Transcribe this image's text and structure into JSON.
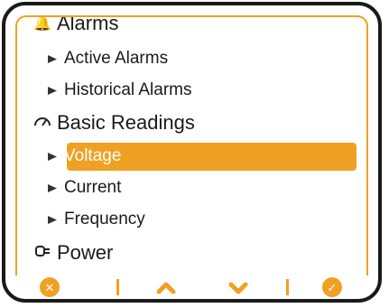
{
  "menu": {
    "items": [
      {
        "type": "section",
        "label": "Alarms",
        "icon": "bell-icon"
      },
      {
        "type": "sub",
        "label": "Active Alarms"
      },
      {
        "type": "sub",
        "label": "Historical Alarms"
      },
      {
        "type": "section",
        "label": "Basic Readings",
        "icon": "gauge-icon"
      },
      {
        "type": "sub",
        "label": "Voltage",
        "selected": true
      },
      {
        "type": "sub",
        "label": "Current"
      },
      {
        "type": "sub",
        "label": "Frequency"
      },
      {
        "type": "section",
        "label": "Power",
        "icon": "plug-icon"
      }
    ]
  },
  "toolbar": {
    "cancel_icon": "close-icon",
    "up_icon": "chevron-up-icon",
    "down_icon": "chevron-down-icon",
    "ok_icon": "checkmark-icon"
  },
  "colors": {
    "accent": "#f0a022",
    "bezel": "#1a1a1a",
    "text": "#1a1a1a"
  }
}
